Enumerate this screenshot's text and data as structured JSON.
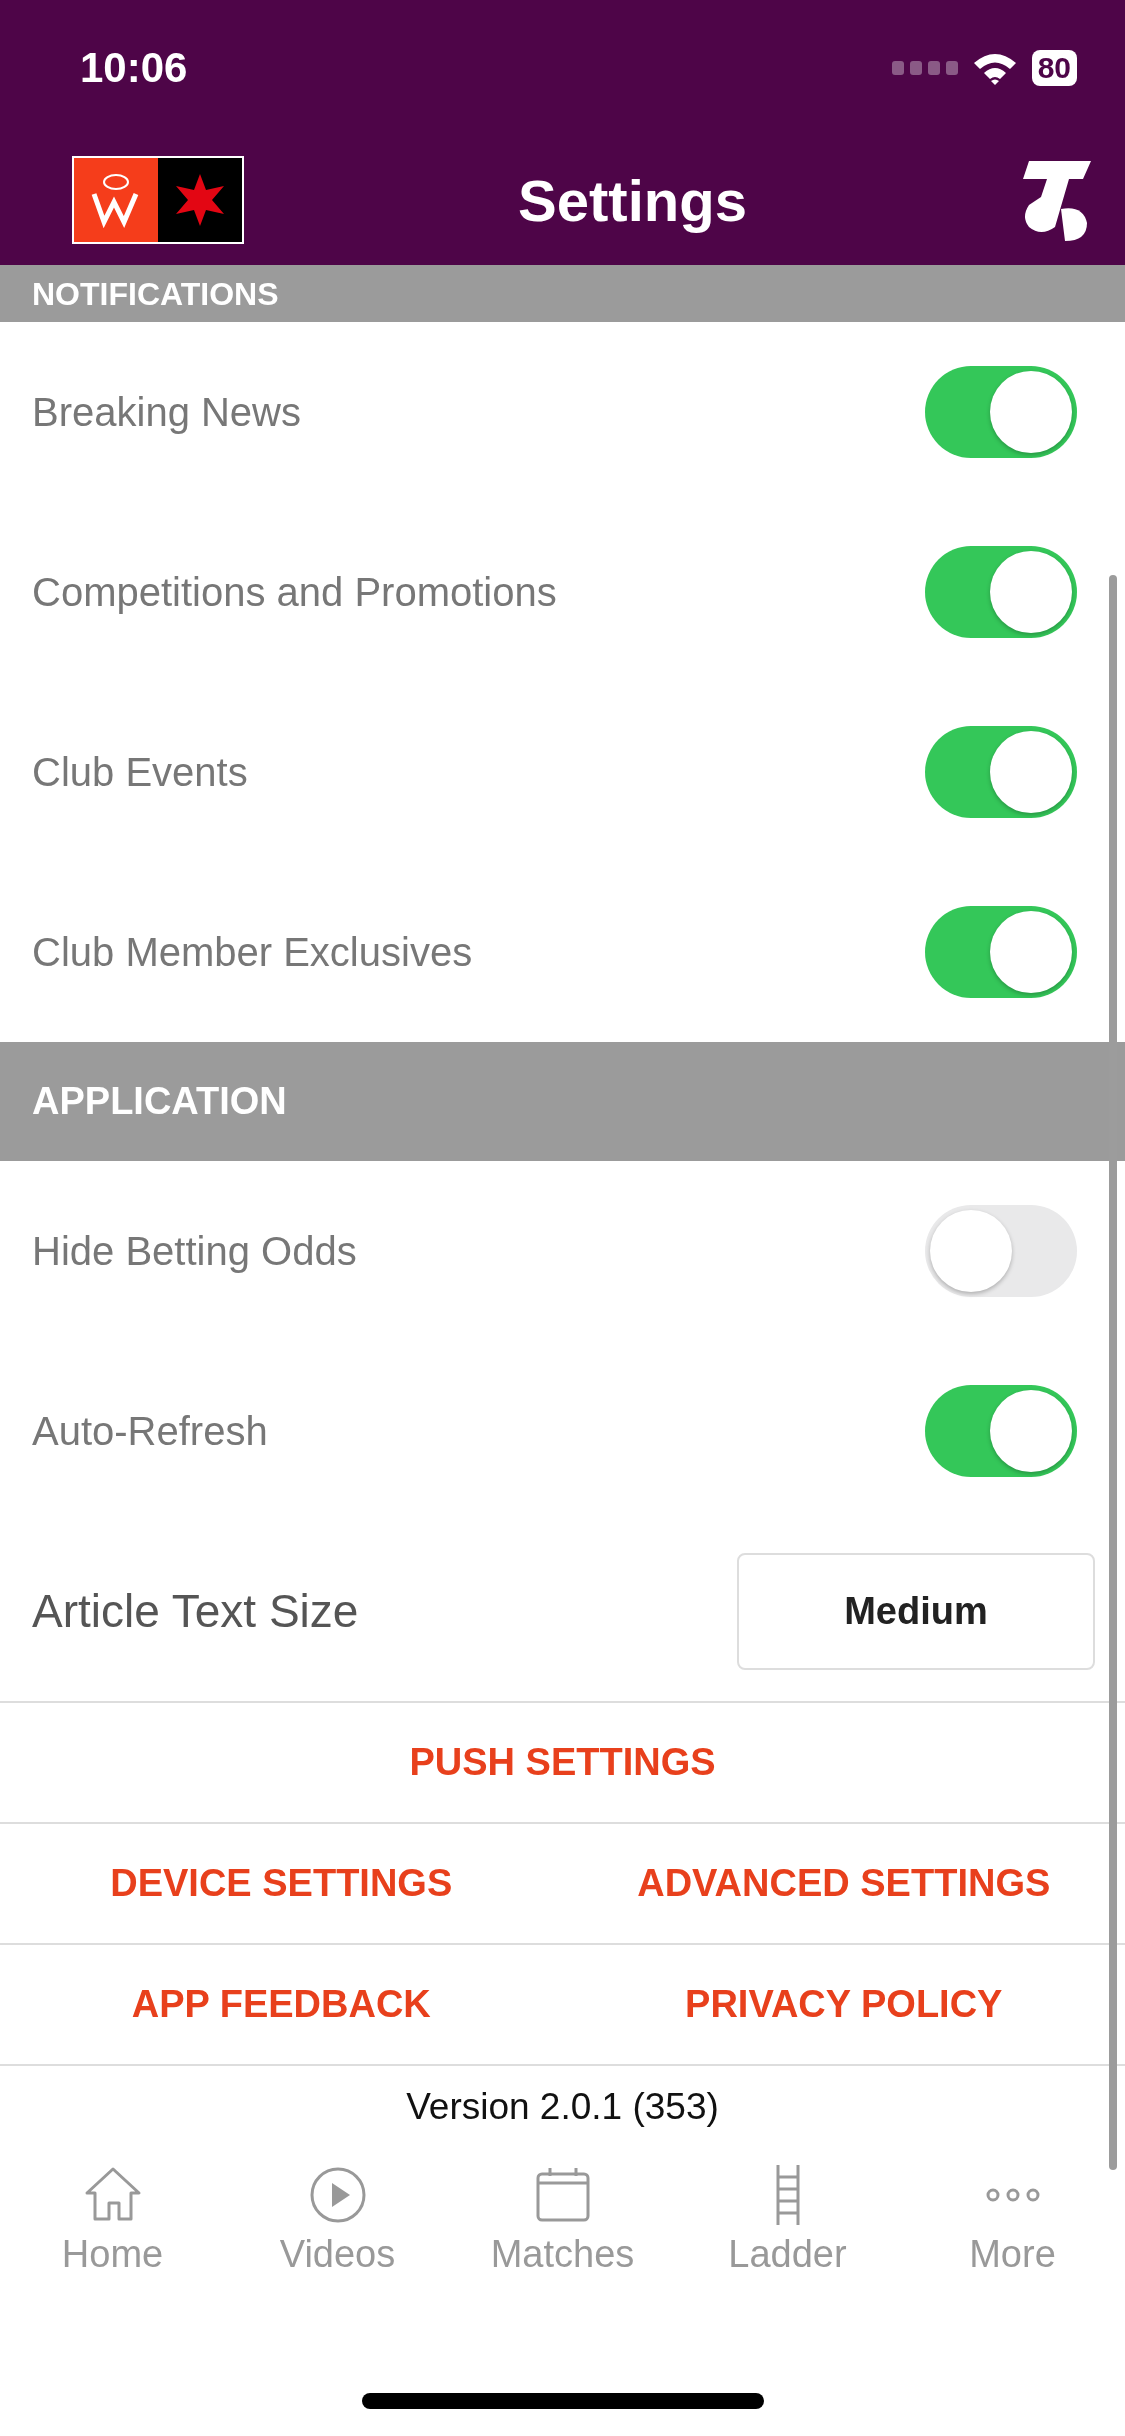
{
  "status_bar": {
    "time": "10:06",
    "battery": "80"
  },
  "header": {
    "title": "Settings"
  },
  "sections": [
    {
      "title": "NOTIFICATIONS",
      "cut": true,
      "rows": [
        {
          "kind": "toggle",
          "label": "Breaking News",
          "on": true
        },
        {
          "kind": "toggle",
          "label": "Competitions and Promotions",
          "on": true
        },
        {
          "kind": "toggle",
          "label": "Club Events",
          "on": true
        },
        {
          "kind": "toggle",
          "label": "Club Member Exclusives",
          "on": true
        }
      ]
    },
    {
      "title": "APPLICATION",
      "cut": false,
      "rows": [
        {
          "kind": "toggle",
          "label": "Hide Betting Odds",
          "on": false
        },
        {
          "kind": "toggle",
          "label": "Auto-Refresh",
          "on": true
        },
        {
          "kind": "choice",
          "label": "Article Text Size",
          "value": "Medium"
        }
      ]
    }
  ],
  "links": [
    [
      "PUSH SETTINGS"
    ],
    [
      "DEVICE SETTINGS",
      "ADVANCED SETTINGS"
    ],
    [
      "APP FEEDBACK",
      "PRIVACY POLICY"
    ]
  ],
  "version": "Version 2.0.1 (353)",
  "tabs": [
    {
      "label": "Home",
      "kind": "home"
    },
    {
      "label": "Videos",
      "kind": "videos"
    },
    {
      "label": "Matches",
      "kind": "matches"
    },
    {
      "label": "Ladder",
      "kind": "ladder"
    },
    {
      "label": "More",
      "kind": "more"
    }
  ]
}
